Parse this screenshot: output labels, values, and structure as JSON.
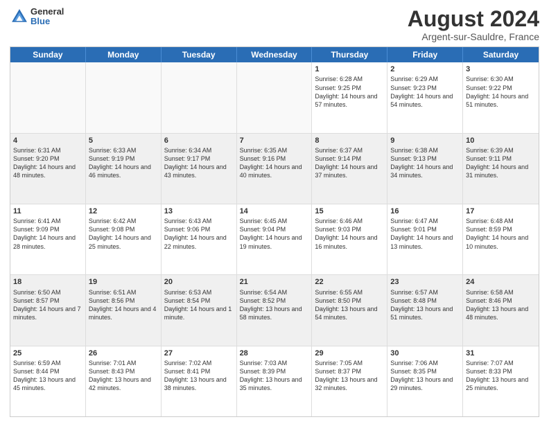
{
  "header": {
    "logo_general": "General",
    "logo_blue": "Blue",
    "month_year": "August 2024",
    "location": "Argent-sur-Sauldre, France"
  },
  "days_of_week": [
    "Sunday",
    "Monday",
    "Tuesday",
    "Wednesday",
    "Thursday",
    "Friday",
    "Saturday"
  ],
  "rows": [
    [
      {
        "day": "",
        "text": "",
        "empty": true
      },
      {
        "day": "",
        "text": "",
        "empty": true
      },
      {
        "day": "",
        "text": "",
        "empty": true
      },
      {
        "day": "",
        "text": "",
        "empty": true
      },
      {
        "day": "1",
        "text": "Sunrise: 6:28 AM\nSunset: 9:25 PM\nDaylight: 14 hours and 57 minutes.",
        "empty": false
      },
      {
        "day": "2",
        "text": "Sunrise: 6:29 AM\nSunset: 9:23 PM\nDaylight: 14 hours and 54 minutes.",
        "empty": false
      },
      {
        "day": "3",
        "text": "Sunrise: 6:30 AM\nSunset: 9:22 PM\nDaylight: 14 hours and 51 minutes.",
        "empty": false
      }
    ],
    [
      {
        "day": "4",
        "text": "Sunrise: 6:31 AM\nSunset: 9:20 PM\nDaylight: 14 hours and 48 minutes.",
        "empty": false
      },
      {
        "day": "5",
        "text": "Sunrise: 6:33 AM\nSunset: 9:19 PM\nDaylight: 14 hours and 46 minutes.",
        "empty": false
      },
      {
        "day": "6",
        "text": "Sunrise: 6:34 AM\nSunset: 9:17 PM\nDaylight: 14 hours and 43 minutes.",
        "empty": false
      },
      {
        "day": "7",
        "text": "Sunrise: 6:35 AM\nSunset: 9:16 PM\nDaylight: 14 hours and 40 minutes.",
        "empty": false
      },
      {
        "day": "8",
        "text": "Sunrise: 6:37 AM\nSunset: 9:14 PM\nDaylight: 14 hours and 37 minutes.",
        "empty": false
      },
      {
        "day": "9",
        "text": "Sunrise: 6:38 AM\nSunset: 9:13 PM\nDaylight: 14 hours and 34 minutes.",
        "empty": false
      },
      {
        "day": "10",
        "text": "Sunrise: 6:39 AM\nSunset: 9:11 PM\nDaylight: 14 hours and 31 minutes.",
        "empty": false
      }
    ],
    [
      {
        "day": "11",
        "text": "Sunrise: 6:41 AM\nSunset: 9:09 PM\nDaylight: 14 hours and 28 minutes.",
        "empty": false
      },
      {
        "day": "12",
        "text": "Sunrise: 6:42 AM\nSunset: 9:08 PM\nDaylight: 14 hours and 25 minutes.",
        "empty": false
      },
      {
        "day": "13",
        "text": "Sunrise: 6:43 AM\nSunset: 9:06 PM\nDaylight: 14 hours and 22 minutes.",
        "empty": false
      },
      {
        "day": "14",
        "text": "Sunrise: 6:45 AM\nSunset: 9:04 PM\nDaylight: 14 hours and 19 minutes.",
        "empty": false
      },
      {
        "day": "15",
        "text": "Sunrise: 6:46 AM\nSunset: 9:03 PM\nDaylight: 14 hours and 16 minutes.",
        "empty": false
      },
      {
        "day": "16",
        "text": "Sunrise: 6:47 AM\nSunset: 9:01 PM\nDaylight: 14 hours and 13 minutes.",
        "empty": false
      },
      {
        "day": "17",
        "text": "Sunrise: 6:48 AM\nSunset: 8:59 PM\nDaylight: 14 hours and 10 minutes.",
        "empty": false
      }
    ],
    [
      {
        "day": "18",
        "text": "Sunrise: 6:50 AM\nSunset: 8:57 PM\nDaylight: 14 hours and 7 minutes.",
        "empty": false
      },
      {
        "day": "19",
        "text": "Sunrise: 6:51 AM\nSunset: 8:56 PM\nDaylight: 14 hours and 4 minutes.",
        "empty": false
      },
      {
        "day": "20",
        "text": "Sunrise: 6:53 AM\nSunset: 8:54 PM\nDaylight: 14 hours and 1 minute.",
        "empty": false
      },
      {
        "day": "21",
        "text": "Sunrise: 6:54 AM\nSunset: 8:52 PM\nDaylight: 13 hours and 58 minutes.",
        "empty": false
      },
      {
        "day": "22",
        "text": "Sunrise: 6:55 AM\nSunset: 8:50 PM\nDaylight: 13 hours and 54 minutes.",
        "empty": false
      },
      {
        "day": "23",
        "text": "Sunrise: 6:57 AM\nSunset: 8:48 PM\nDaylight: 13 hours and 51 minutes.",
        "empty": false
      },
      {
        "day": "24",
        "text": "Sunrise: 6:58 AM\nSunset: 8:46 PM\nDaylight: 13 hours and 48 minutes.",
        "empty": false
      }
    ],
    [
      {
        "day": "25",
        "text": "Sunrise: 6:59 AM\nSunset: 8:44 PM\nDaylight: 13 hours and 45 minutes.",
        "empty": false
      },
      {
        "day": "26",
        "text": "Sunrise: 7:01 AM\nSunset: 8:43 PM\nDaylight: 13 hours and 42 minutes.",
        "empty": false
      },
      {
        "day": "27",
        "text": "Sunrise: 7:02 AM\nSunset: 8:41 PM\nDaylight: 13 hours and 38 minutes.",
        "empty": false
      },
      {
        "day": "28",
        "text": "Sunrise: 7:03 AM\nSunset: 8:39 PM\nDaylight: 13 hours and 35 minutes.",
        "empty": false
      },
      {
        "day": "29",
        "text": "Sunrise: 7:05 AM\nSunset: 8:37 PM\nDaylight: 13 hours and 32 minutes.",
        "empty": false
      },
      {
        "day": "30",
        "text": "Sunrise: 7:06 AM\nSunset: 8:35 PM\nDaylight: 13 hours and 29 minutes.",
        "empty": false
      },
      {
        "day": "31",
        "text": "Sunrise: 7:07 AM\nSunset: 8:33 PM\nDaylight: 13 hours and 25 minutes.",
        "empty": false
      }
    ]
  ]
}
